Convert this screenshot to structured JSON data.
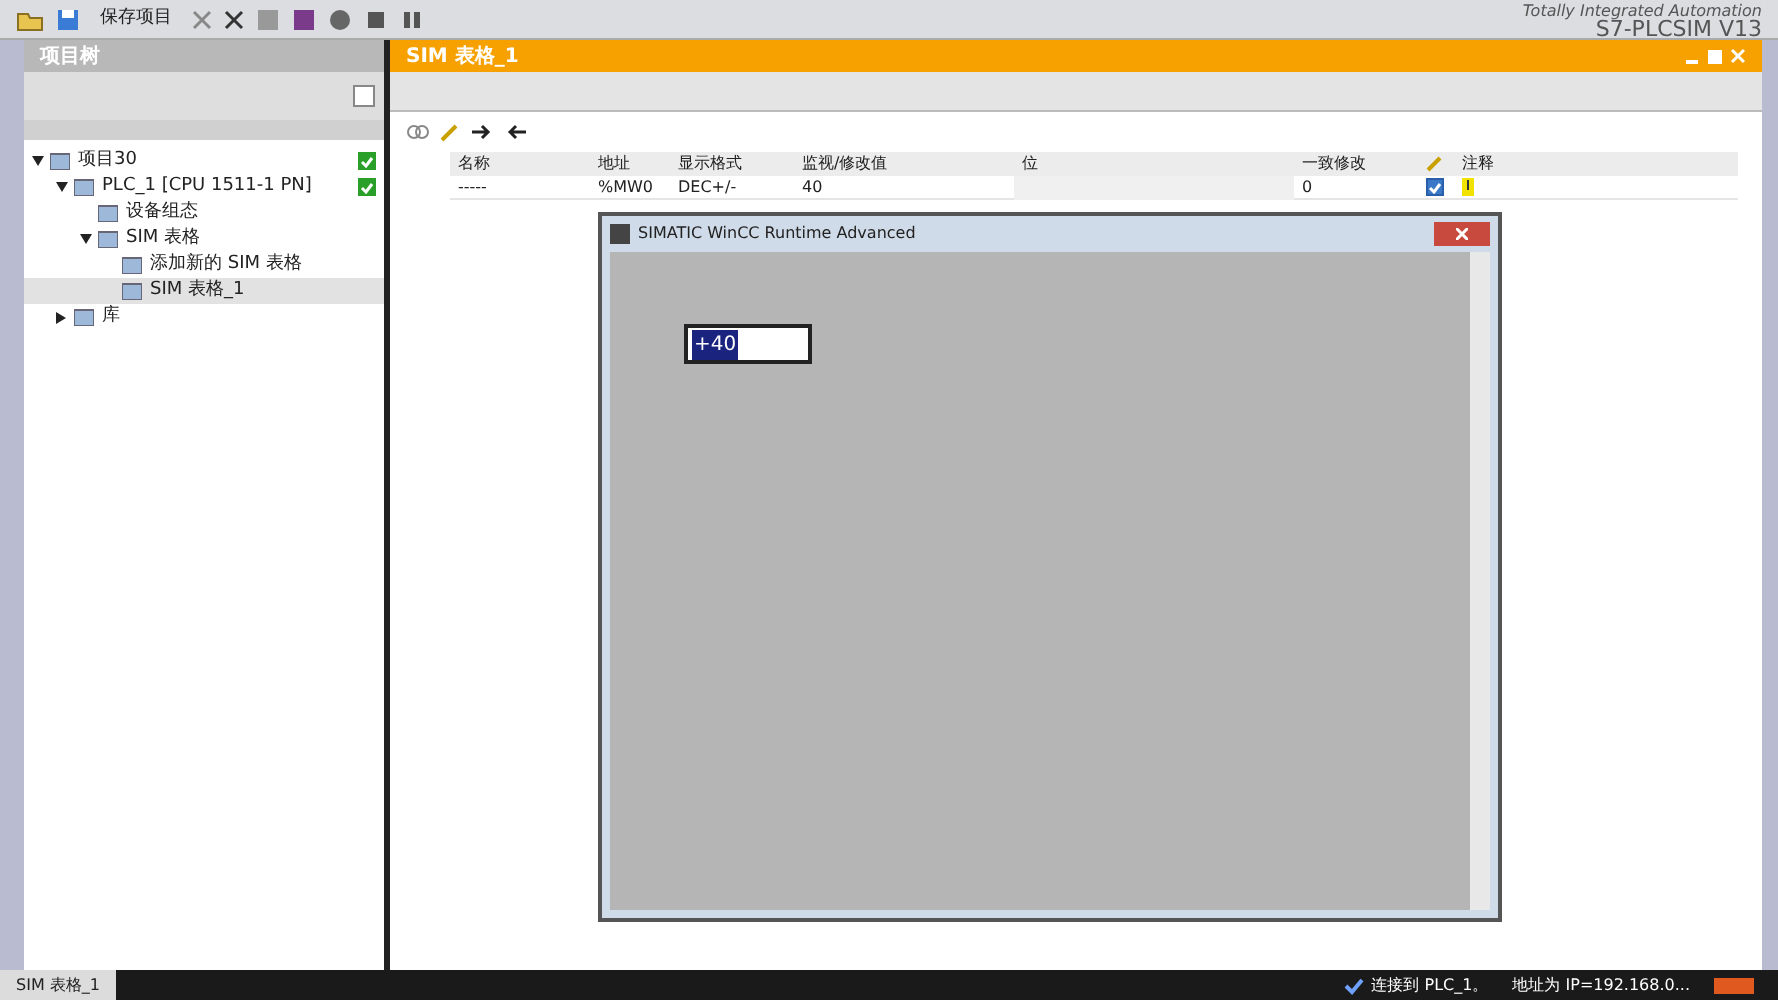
{
  "toolbar": {
    "save_label": "保存项目",
    "brand_line": "Totally Integrated Automation",
    "product": "S7-PLCSIM V13"
  },
  "project_tree": {
    "title": "项目树",
    "items": [
      {
        "label": "项目30",
        "expanded": true,
        "ok": true,
        "selected": false,
        "children": [
          {
            "label": "PLC_1 [CPU 1511-1 PN]",
            "expanded": true,
            "ok": true,
            "selected": false,
            "children": [
              {
                "label": "设备组态",
                "selected": false
              },
              {
                "label": "SIM 表格",
                "expanded": true,
                "selected": false,
                "children": [
                  {
                    "label": "添加新的 SIM 表格",
                    "selected": false
                  },
                  {
                    "label": "SIM 表格_1",
                    "selected": true
                  }
                ]
              }
            ]
          },
          {
            "label": "库",
            "expanded": false,
            "selected": false
          }
        ]
      }
    ]
  },
  "sim_table": {
    "title": "SIM 表格_1",
    "columns": [
      "名称",
      "地址",
      "显示格式",
      "监视/修改值",
      "位",
      "一致修改",
      "注释"
    ],
    "rows": [
      {
        "name": "-----",
        "address": "%MW0",
        "format": "DEC+/-",
        "value": "40",
        "consistent": "0",
        "enabled": true
      }
    ]
  },
  "runtime_window": {
    "title": "SIMATIC WinCC Runtime Advanced",
    "field_value": "+40"
  },
  "taskbar": {
    "tab": "SIM 表格_1",
    "status": "连接到 PLC_1。",
    "address": "地址为 IP=192.168.0..."
  }
}
